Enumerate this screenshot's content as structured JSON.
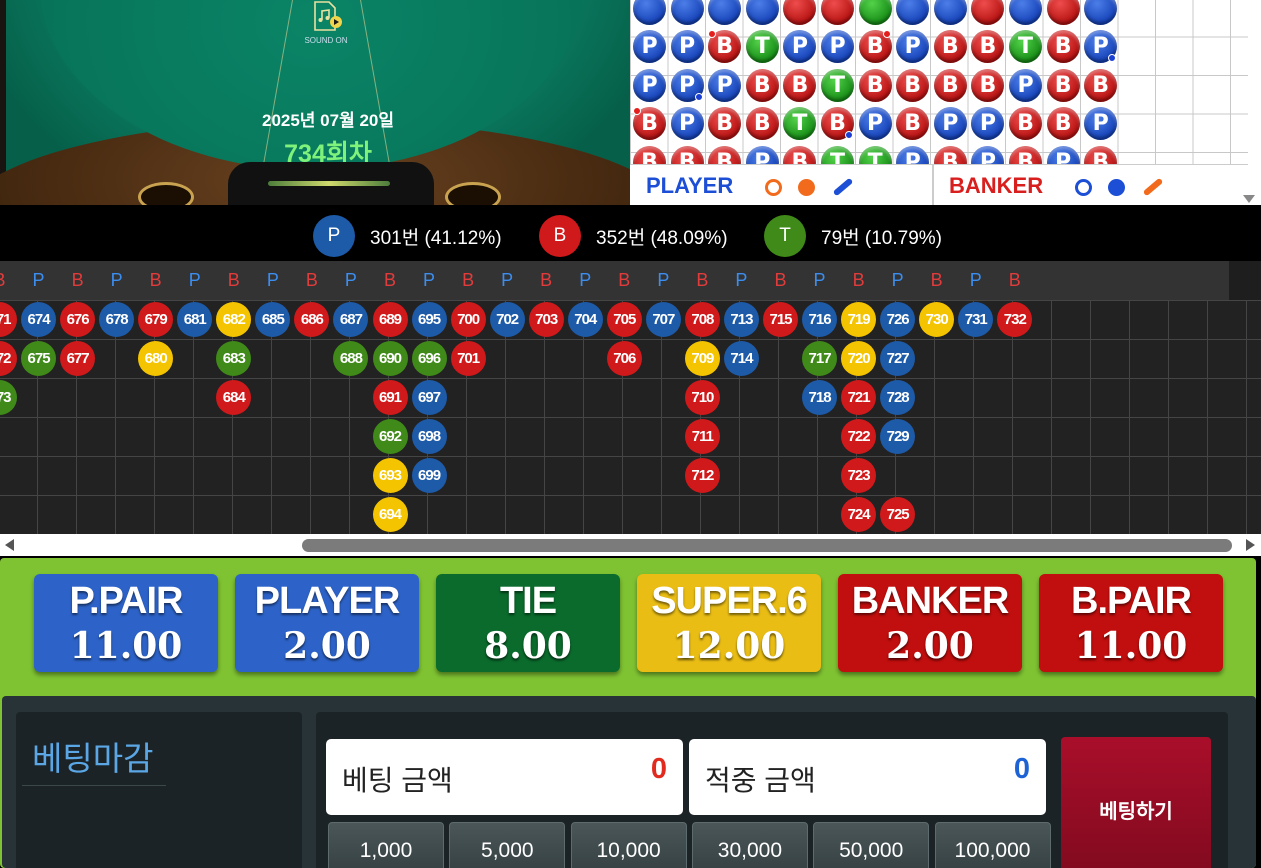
{
  "table": {
    "sound_label": "SOUND ON",
    "date": "2025년 07월 20일",
    "round": "734회차"
  },
  "bead_road": {
    "rows": [
      [
        "P",
        "P",
        "B",
        "T",
        "P",
        "P",
        "B",
        "P",
        "B",
        "B",
        "T",
        "B",
        "P"
      ],
      [
        "P",
        "P",
        "P",
        "B",
        "B",
        "T",
        "B",
        "B",
        "B",
        "B",
        "P",
        "B",
        "B"
      ],
      [
        "B",
        "P",
        "B",
        "B",
        "T",
        "B",
        "P",
        "B",
        "P",
        "P",
        "B",
        "B",
        "P"
      ],
      [
        "B",
        "B",
        "B",
        "P",
        "B",
        "T",
        "T",
        "P",
        "B",
        "P",
        "B",
        "P",
        "B"
      ]
    ],
    "legend": {
      "player_label": "PLAYER",
      "banker_label": "BANKER",
      "player_color": "#1c4fd6",
      "banker_color": "#d91e1e"
    }
  },
  "stats": {
    "player": {
      "letter": "P",
      "text": "301번 (41.12%)",
      "color": "#1d5aa8"
    },
    "banker": {
      "letter": "B",
      "text": "352번 (48.09%)",
      "color": "#d0191b"
    },
    "tie": {
      "letter": "T",
      "text": "79번 (10.79%)",
      "color": "#3f8a18"
    }
  },
  "big_road": {
    "header": [
      "B",
      "P",
      "B",
      "P",
      "B",
      "P",
      "B",
      "P",
      "B",
      "P",
      "B",
      "P",
      "B",
      "P",
      "B",
      "P",
      "B",
      "P",
      "B",
      "P",
      "B",
      "P",
      "B",
      "P",
      "B",
      "P",
      "B"
    ],
    "columns": [
      [
        {
          "n": "671",
          "t": "B"
        },
        {
          "n": "672",
          "t": "B"
        },
        {
          "n": "673",
          "t": "T"
        }
      ],
      [
        {
          "n": "674",
          "t": "P"
        },
        {
          "n": "675",
          "t": "T"
        }
      ],
      [
        {
          "n": "676",
          "t": "B"
        },
        {
          "n": "677",
          "t": "B"
        }
      ],
      [
        {
          "n": "678",
          "t": "P"
        }
      ],
      [
        {
          "n": "679",
          "t": "B"
        },
        {
          "n": "680",
          "t": "S"
        }
      ],
      [
        {
          "n": "681",
          "t": "P"
        }
      ],
      [
        {
          "n": "682",
          "t": "S"
        },
        {
          "n": "683",
          "t": "T"
        },
        {
          "n": "684",
          "t": "B"
        }
      ],
      [
        {
          "n": "685",
          "t": "P"
        }
      ],
      [
        {
          "n": "686",
          "t": "B"
        }
      ],
      [
        {
          "n": "687",
          "t": "P"
        },
        {
          "n": "688",
          "t": "T"
        }
      ],
      [
        {
          "n": "689",
          "t": "B"
        },
        {
          "n": "690",
          "t": "T"
        },
        {
          "n": "691",
          "t": "B"
        },
        {
          "n": "692",
          "t": "T"
        },
        {
          "n": "693",
          "t": "S"
        },
        {
          "n": "694",
          "t": "S"
        }
      ],
      [
        {
          "n": "695",
          "t": "P"
        },
        {
          "n": "696",
          "t": "T"
        },
        {
          "n": "697",
          "t": "P"
        },
        {
          "n": "698",
          "t": "P"
        },
        {
          "n": "699",
          "t": "P"
        }
      ],
      [
        {
          "n": "700",
          "t": "B"
        },
        {
          "n": "701",
          "t": "B"
        }
      ],
      [
        {
          "n": "702",
          "t": "P"
        }
      ],
      [
        {
          "n": "703",
          "t": "B"
        }
      ],
      [
        {
          "n": "704",
          "t": "P"
        }
      ],
      [
        {
          "n": "705",
          "t": "B"
        },
        {
          "n": "706",
          "t": "B"
        }
      ],
      [
        {
          "n": "707",
          "t": "P"
        }
      ],
      [
        {
          "n": "708",
          "t": "B"
        },
        {
          "n": "709",
          "t": "S"
        },
        {
          "n": "710",
          "t": "B"
        },
        {
          "n": "711",
          "t": "B"
        },
        {
          "n": "712",
          "t": "B"
        }
      ],
      [
        {
          "n": "713",
          "t": "P"
        },
        {
          "n": "714",
          "t": "P"
        }
      ],
      [
        {
          "n": "715",
          "t": "B"
        }
      ],
      [
        {
          "n": "716",
          "t": "P"
        },
        {
          "n": "717",
          "t": "T"
        },
        {
          "n": "718",
          "t": "P"
        }
      ],
      [
        {
          "n": "719",
          "t": "S"
        },
        {
          "n": "720",
          "t": "S"
        },
        {
          "n": "721",
          "t": "B"
        },
        {
          "n": "722",
          "t": "B"
        },
        {
          "n": "723",
          "t": "B"
        },
        {
          "n": "724",
          "t": "B"
        }
      ],
      [
        {
          "n": "726",
          "t": "P"
        },
        {
          "n": "727",
          "t": "P"
        },
        {
          "n": "728",
          "t": "P"
        },
        {
          "n": "729",
          "t": "P"
        },
        null,
        {
          "n": "725",
          "t": "B"
        }
      ],
      [
        {
          "n": "730",
          "t": "S"
        }
      ],
      [
        {
          "n": "731",
          "t": "P"
        }
      ],
      [
        {
          "n": "732",
          "t": "B"
        }
      ]
    ]
  },
  "bets": [
    {
      "name": "P.PAIR",
      "odds": "11.00",
      "color": "#2d63c8"
    },
    {
      "name": "PLAYER",
      "odds": "2.00",
      "color": "#2d63c8"
    },
    {
      "name": "TIE",
      "odds": "8.00",
      "color": "#0a6b2c"
    },
    {
      "name": "SUPER.6",
      "odds": "12.00",
      "color": "#e9bd14"
    },
    {
      "name": "BANKER",
      "odds": "2.00",
      "color": "#c10e0e"
    },
    {
      "name": "B.PAIR",
      "odds": "11.00",
      "color": "#c10e0e"
    }
  ],
  "status": {
    "label": "베팅마감"
  },
  "amounts": {
    "bet_label": "베팅 금액",
    "bet_value": "0",
    "win_label": "적중 금액",
    "win_value": "0"
  },
  "chips": [
    "1,000",
    "5,000",
    "10,000",
    "30,000",
    "50,000",
    "100,000"
  ],
  "place_bet_label": "베팅하기"
}
